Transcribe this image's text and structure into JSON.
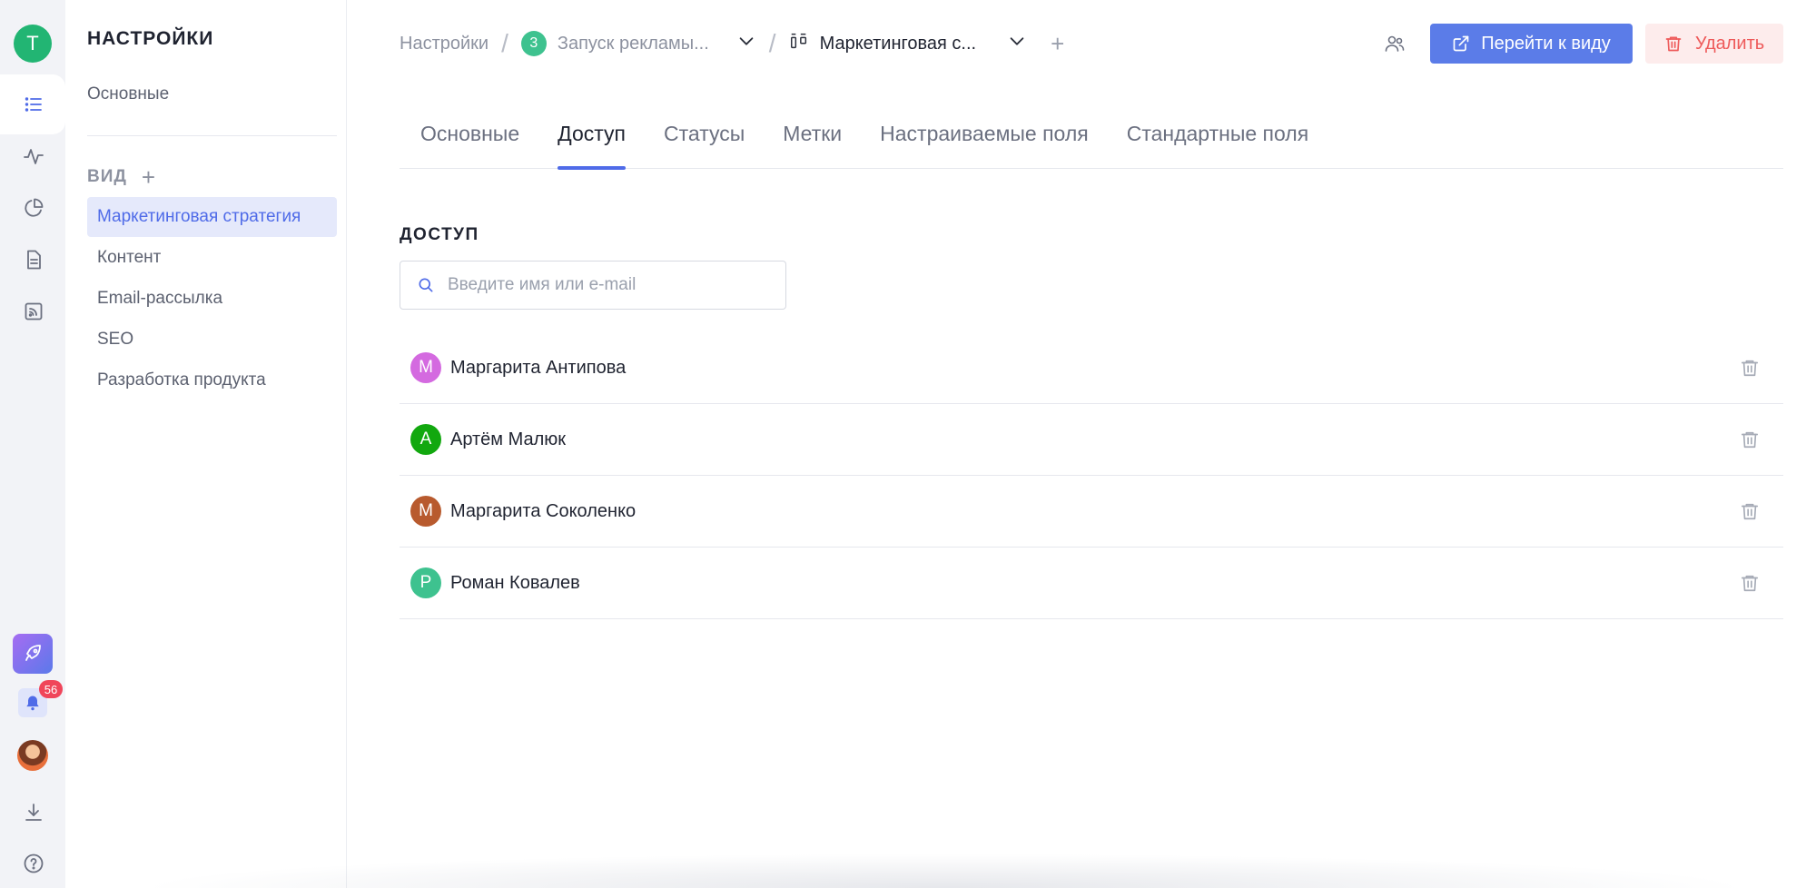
{
  "rail": {
    "logo_letter": "T",
    "notifications_count": "56",
    "icons": [
      "list-icon",
      "activity-icon",
      "pie-chart-icon",
      "document-icon",
      "feed-icon",
      "rocket-icon",
      "bell-icon",
      "download-icon",
      "help-icon"
    ]
  },
  "settings": {
    "title": "НАСТРОЙКИ",
    "basic_link": "Основные",
    "view_section_label": "ВИД",
    "view_add_label": "+",
    "views": [
      {
        "label": "Маркетинговая стратегия",
        "selected": true
      },
      {
        "label": "Контент",
        "selected": false
      },
      {
        "label": "Email-рассылка",
        "selected": false
      },
      {
        "label": "SEO",
        "selected": false
      },
      {
        "label": "Разработка продукта",
        "selected": false
      }
    ]
  },
  "breadcrumb": {
    "root": "Настройки",
    "project_number": "3",
    "project_name": "Запуск рекламы...",
    "view_name": "Маркетинговая с...",
    "add_label": "+"
  },
  "header": {
    "goto_button": "Перейти к виду",
    "delete_button": "Удалить",
    "accent_color": "#5b7ce8",
    "danger_color": "#ee5a5a"
  },
  "tabs": [
    {
      "label": "Основные",
      "active": false
    },
    {
      "label": "Доступ",
      "active": true
    },
    {
      "label": "Статусы",
      "active": false
    },
    {
      "label": "Метки",
      "active": false
    },
    {
      "label": "Настраиваемые поля",
      "active": false
    },
    {
      "label": "Стандартные поля",
      "active": false
    }
  ],
  "access": {
    "title": "ДОСТУП",
    "search_placeholder": "Введите имя или e-mail",
    "search_value": "",
    "members": [
      {
        "initial": "М",
        "name": "Маргарита Антипова",
        "color": "#d46ae0"
      },
      {
        "initial": "А",
        "name": "Артём Малюк",
        "color": "#12a80f"
      },
      {
        "initial": "М",
        "name": "Маргарита Соколенко",
        "color": "#b85a2e"
      },
      {
        "initial": "Р",
        "name": "Роман Ковалев",
        "color": "#3ec28f"
      }
    ]
  }
}
